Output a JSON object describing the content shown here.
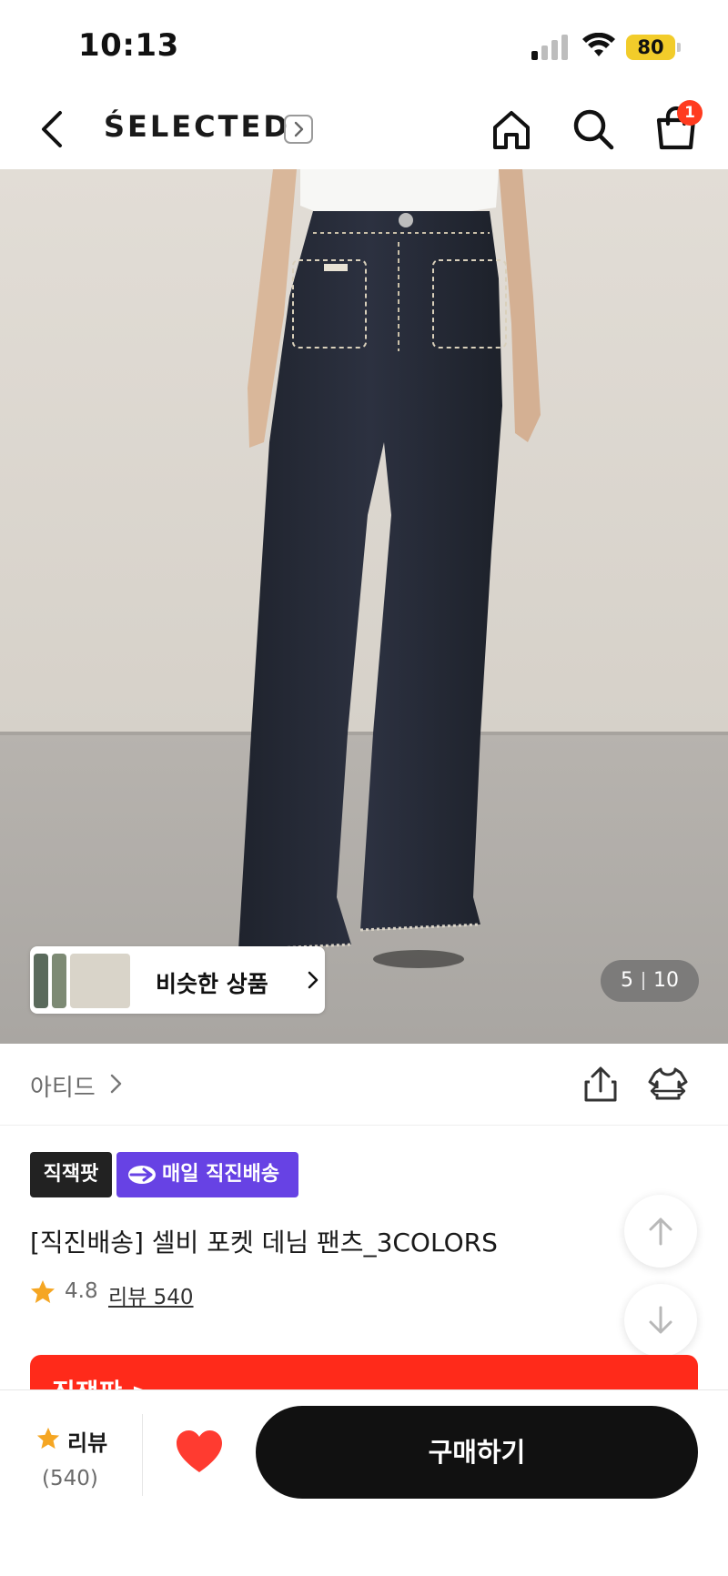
{
  "status_bar": {
    "time": "10:13",
    "battery": "80",
    "icons": [
      "cellular-signal-icon",
      "wifi-icon",
      "battery-icon"
    ]
  },
  "nav": {
    "brand": "ŚELECTED",
    "cart_count": "1",
    "icons": [
      "back-chevron-icon",
      "brand-arrow-icon",
      "home-icon",
      "search-icon",
      "shopping-bag-icon"
    ]
  },
  "gallery": {
    "similar_label": "비슷한 상품",
    "current_page": "5",
    "total_pages": "10"
  },
  "seller": {
    "name": "아티드",
    "icons": [
      "chevron-right-icon",
      "share-icon",
      "fitting-shirt-icon"
    ]
  },
  "tags": {
    "dark": "직잭팟",
    "purple": "매일 직진배송"
  },
  "product": {
    "title": "[직진배송] 셀비 포켓 데님 팬츠_3COLORS",
    "rating": "4.8",
    "review_link": "리뷰 540"
  },
  "promo": {
    "text": "직잭팟 >"
  },
  "bottom_bar": {
    "review_label": "리뷰",
    "review_count": "(540)",
    "buy_label": "구매하기"
  },
  "colors": {
    "accent_purple": "#6742e4",
    "badge_red": "#ff3b1f",
    "promo_red": "#ff2a1a",
    "star_yellow": "#f5a623",
    "heart_red": "#ff3b30",
    "battery_yellow": "#f2cc2a"
  }
}
